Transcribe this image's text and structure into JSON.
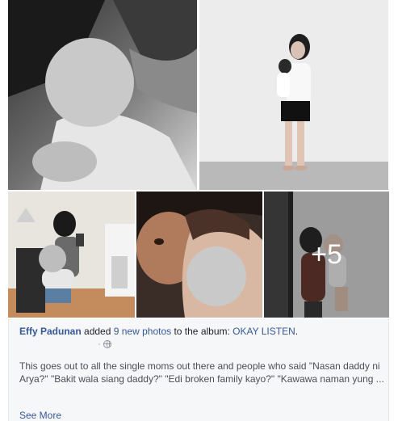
{
  "album_grid": {
    "photos": [
      {
        "name": "photo-1",
        "alt_icon": "photo"
      },
      {
        "name": "photo-2",
        "alt_icon": "photo"
      },
      {
        "name": "photo-3",
        "alt_icon": "photo"
      },
      {
        "name": "photo-4",
        "alt_icon": "photo"
      },
      {
        "name": "photo-5",
        "alt_icon": "photo"
      }
    ],
    "more_count_label": "+5"
  },
  "story": {
    "author": "Effy Padunan",
    "verb": " added ",
    "photo_count_link": "9 new photos",
    "middle_text": " to the album: ",
    "album_link": "OKAY LISTEN",
    "end_punct": ".",
    "meta_separator": "·",
    "privacy_icon": "globe-icon"
  },
  "caption": {
    "text": "This goes out to all the single moms out there and people who said \"Nasan daddy ni Arya?\" \"Bakit wala siang daddy?\" \"Edi broken family kayo?\" \"Kawawa naman yung ...",
    "see_more": "See More"
  },
  "colors": {
    "link": "#365899",
    "panel_bg": "#f6f7f9",
    "meta": "#90949c"
  }
}
